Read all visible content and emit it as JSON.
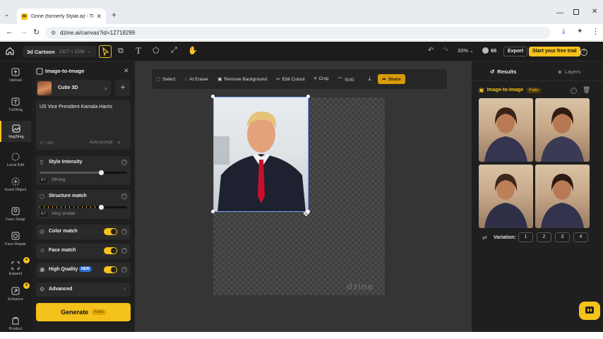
{
  "browser": {
    "tab_title": "Dzine (formerly Stylar.ai) - The",
    "url": "dzine.ai/canvas?id=12718299"
  },
  "topbar": {
    "project_name": "3d Cartoon",
    "dimensions": "1327 × 1536",
    "zoom": "33%",
    "credits": "66",
    "export_label": "Export",
    "trial_label": "Start your free trial"
  },
  "sidebar": {
    "items": [
      {
        "label": "Upload",
        "icon": "upload-icon"
      },
      {
        "label": "Txt2Img",
        "icon": "txt2img-icon"
      },
      {
        "label": "Img2Img",
        "icon": "img2img-icon"
      },
      {
        "label": "Local Edit",
        "icon": "local-edit-icon"
      },
      {
        "label": "Insert Object",
        "icon": "insert-object-icon"
      },
      {
        "label": "Face Swap",
        "icon": "face-swap-icon"
      },
      {
        "label": "Face Repair",
        "icon": "face-repair-icon"
      },
      {
        "label": "Expand",
        "icon": "expand-icon"
      },
      {
        "label": "Enhance",
        "icon": "enhance-icon"
      },
      {
        "label": "Product",
        "icon": "product-icon"
      }
    ]
  },
  "panel": {
    "title": "Image-to-Image",
    "style_name": "Cutie 3D",
    "prompt": "US Vice President Kamala Harris",
    "char_count": "27 / 800",
    "auto_prompt": "Auto prompt",
    "style_intensity": {
      "label": "Style Intensity",
      "value": "0.7",
      "desc": "Strong",
      "level": 0.7
    },
    "structure_match": {
      "label": "Structure match",
      "value": "0.7",
      "desc": "Very similar",
      "level": 0.7
    },
    "color_match": "Color match",
    "face_match": "Face match",
    "high_quality": "High Quality",
    "new_badge": "NEW",
    "advanced": "Advanced",
    "generate": "Generate",
    "public_badge": "Public"
  },
  "toolbar": {
    "select": "Select",
    "ai_eraser": "AI Eraser",
    "remove_bg": "Remove Background",
    "edit_cutout": "Edit Cutout",
    "crop": "Crop",
    "svg": "SVG",
    "share": "Share"
  },
  "canvas": {
    "watermark": "dzine"
  },
  "right": {
    "results_tab": "Results",
    "layers_tab": "Layers",
    "section_title": "Image-to-Image",
    "public_badge": "Public",
    "variation_label": "Variation:",
    "variations": [
      "1",
      "2",
      "3",
      "4"
    ]
  },
  "colors": {
    "accent": "#f5c21b",
    "app_bg": "#1c1c1c",
    "canvas_bg": "#353535",
    "badge_blue": "#2d6ee0"
  }
}
